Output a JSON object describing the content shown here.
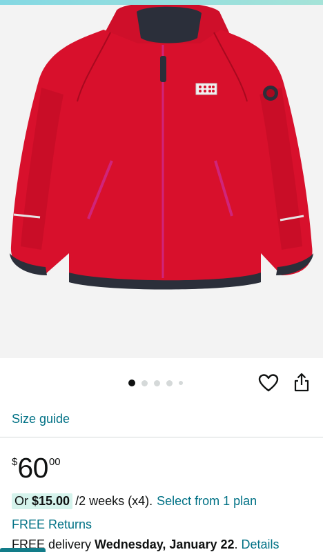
{
  "product": {
    "image_alt": "Red softshell hooded jacket",
    "gallery": {
      "total_images": 5,
      "active_index": 0
    }
  },
  "actions": {
    "wishlist_icon": "heart-icon",
    "share_icon": "share-icon"
  },
  "size_guide": {
    "label": "Size guide"
  },
  "price": {
    "symbol": "$",
    "whole": "60",
    "fraction": "00"
  },
  "plan": {
    "prefix": "Or",
    "amount": "$15.00",
    "terms": "/2 weeks (x4).",
    "link": "Select from 1 plan"
  },
  "returns": {
    "label": "FREE Returns"
  },
  "delivery": {
    "prefix": "FREE delivery",
    "date": "Wednesday, January 22",
    "separator": ".",
    "details_link": "Details"
  },
  "colors": {
    "link": "#007185",
    "plan_highlight": "#d5f3ec",
    "jacket_red": "#d8102c"
  }
}
